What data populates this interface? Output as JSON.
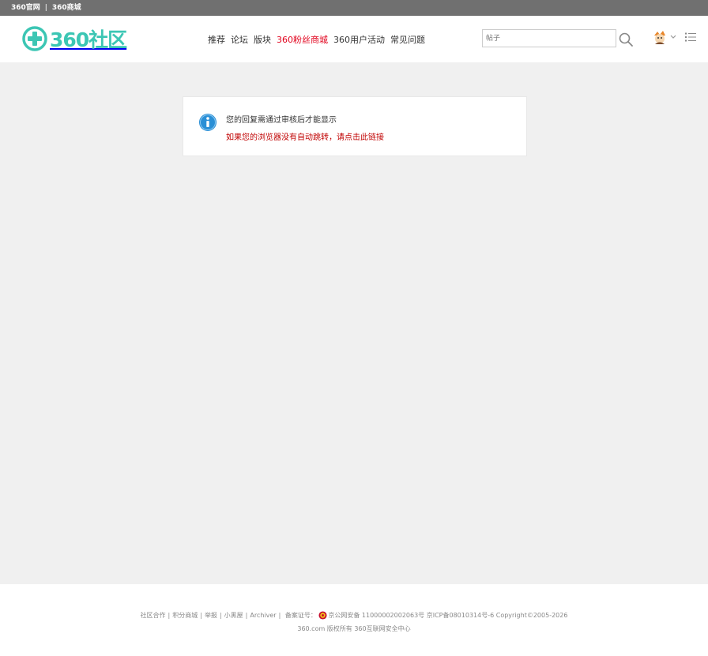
{
  "topbar": {
    "link1": "360官网",
    "separator": "|",
    "link2": "360商城"
  },
  "header": {
    "logo_text": "360社区",
    "nav": [
      {
        "label": "推荐"
      },
      {
        "label": "论坛"
      },
      {
        "label": "版块"
      },
      {
        "label": "360粉丝商城"
      },
      {
        "label": "360用户活动"
      },
      {
        "label": "常见问题"
      }
    ],
    "search_placeholder": "帖子",
    "icons": {
      "search": "search-icon",
      "avatar": "avatar-icon",
      "dropdown": "chevron-down-icon",
      "menu": "list-menu-icon"
    }
  },
  "notice": {
    "icon": "info-icon",
    "message": "您的回复需通过审核后才能显示",
    "redirect_text": "如果您的浏览器没有自动跳转，请点击此链接"
  },
  "footer": {
    "links": [
      {
        "label": "社区合作"
      },
      {
        "label": "积分商城"
      },
      {
        "label": "举报"
      },
      {
        "label": "小黑屋"
      },
      {
        "label": "Archiver"
      }
    ],
    "record_label": "备案证号：",
    "police_record": "京公网安备 11000002002063号",
    "icp": "京ICP备08010314号-6",
    "copyright": "Copyright©2005-2026",
    "line2": "360.com 版权所有 360互联网安全中心"
  },
  "colors": {
    "accent": "#3cc6b4",
    "highlight_nav": "#e1001b",
    "link_red": "#c00000",
    "topbar_bg": "#707070",
    "page_bg": "#f0f0f0",
    "info_blue": "#2a8fd6"
  }
}
